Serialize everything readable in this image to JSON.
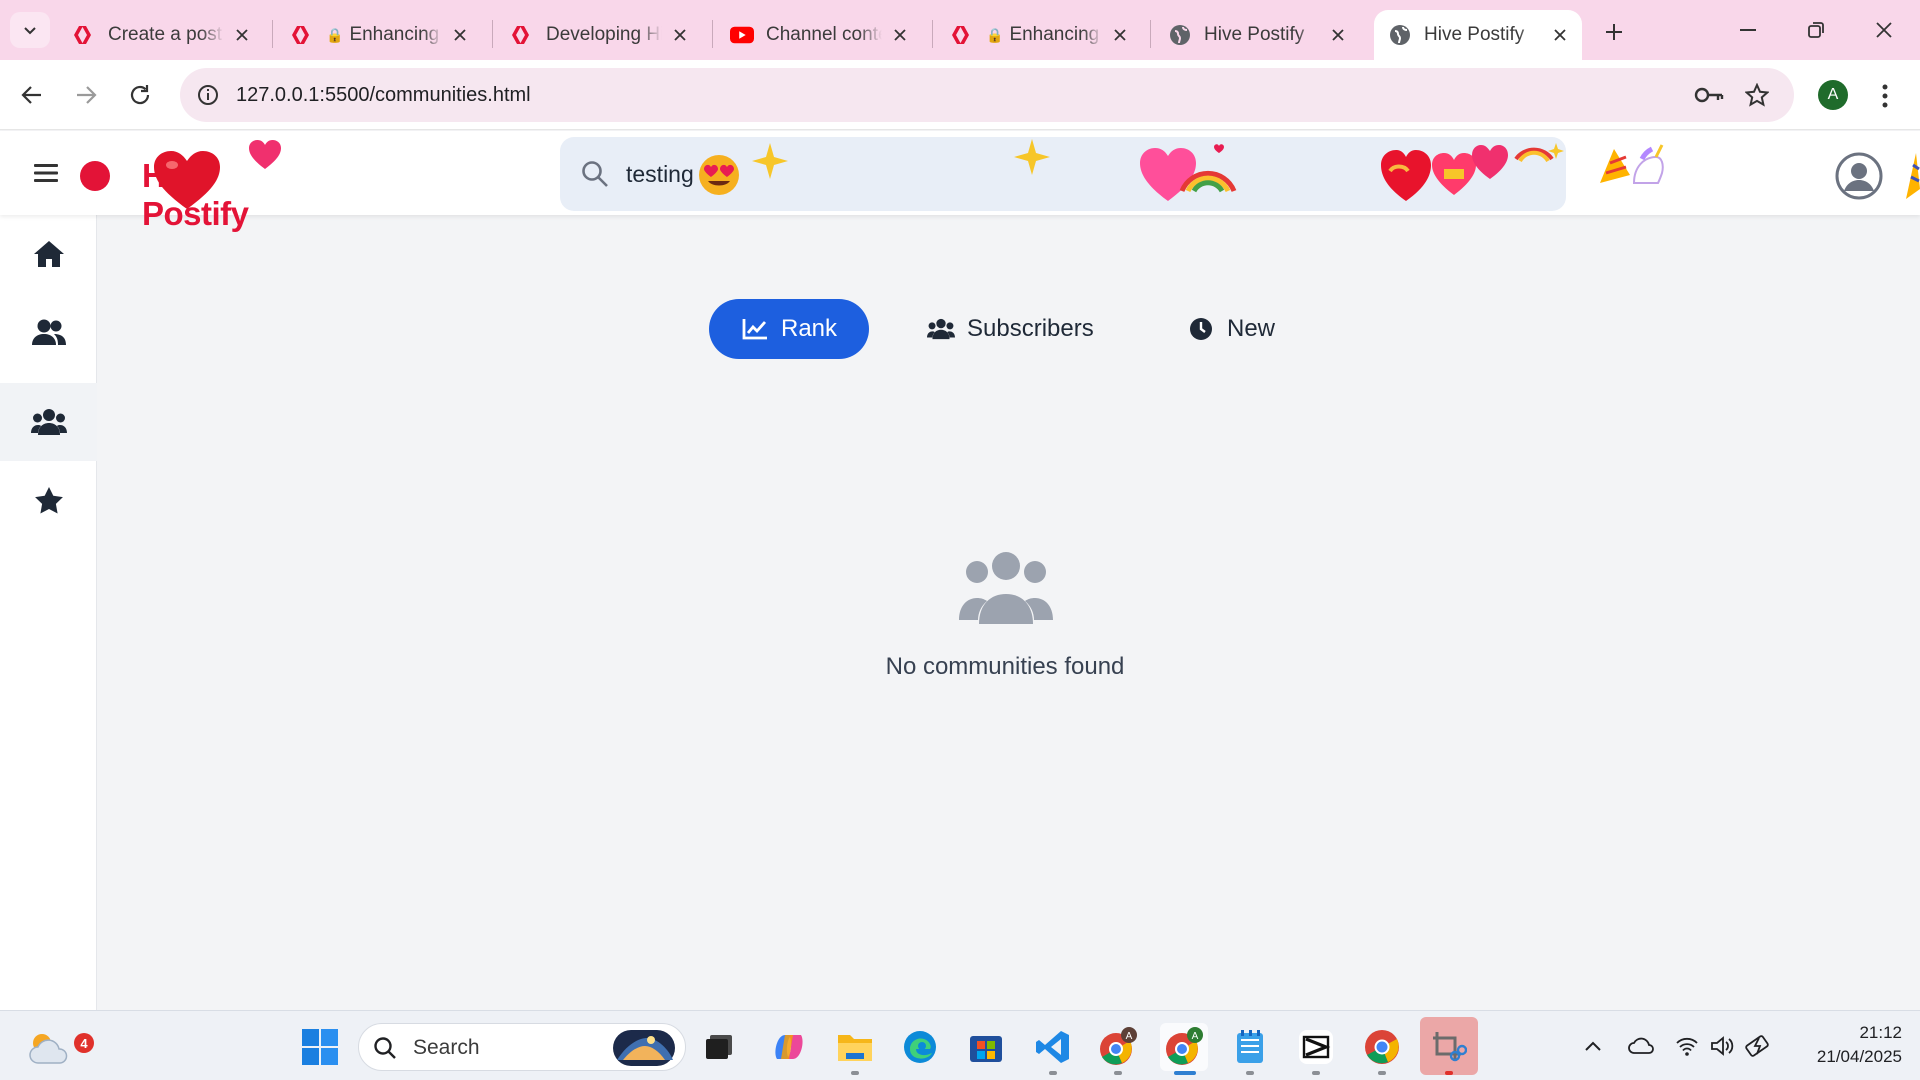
{
  "browser": {
    "tabs": [
      {
        "title": "Create a post",
        "favicon": "hive-icon",
        "locked": false,
        "active": false
      },
      {
        "title": "Enhancing",
        "favicon": "hive-icon",
        "locked": true,
        "active": false
      },
      {
        "title": "Developing Hi",
        "favicon": "hive-icon",
        "locked": false,
        "active": false
      },
      {
        "title": "Channel conte",
        "favicon": "youtube-icon",
        "locked": false,
        "active": false
      },
      {
        "title": "Enhancing",
        "favicon": "hive-icon",
        "locked": true,
        "active": false
      },
      {
        "title": "Hive Postify",
        "favicon": "globe-icon",
        "locked": false,
        "active": false
      },
      {
        "title": "Hive Postify",
        "favicon": "globe-icon",
        "locked": false,
        "active": true
      }
    ],
    "url": "127.0.0.1:5500/communities.html",
    "profile_initial": "A"
  },
  "app": {
    "logo_text": "Hive Postify",
    "search_value": "testing",
    "sidebar": [
      "home-icon",
      "users-icon",
      "communities-icon",
      "star-icon"
    ],
    "tabs": [
      {
        "label": "Rank",
        "icon": "chart-line-icon",
        "active": true
      },
      {
        "label": "Subscribers",
        "icon": "users-icon",
        "active": false
      },
      {
        "label": "New",
        "icon": "clock-icon",
        "active": false
      }
    ],
    "empty_message": "No communities found"
  },
  "taskbar": {
    "search_placeholder": "Search",
    "weather_badge": "4",
    "time": "21:12",
    "date": "21/04/2025"
  },
  "colors": {
    "accent": "#1d5fdf",
    "brand": "#e31337",
    "tabbar": "#f9d7ea"
  }
}
